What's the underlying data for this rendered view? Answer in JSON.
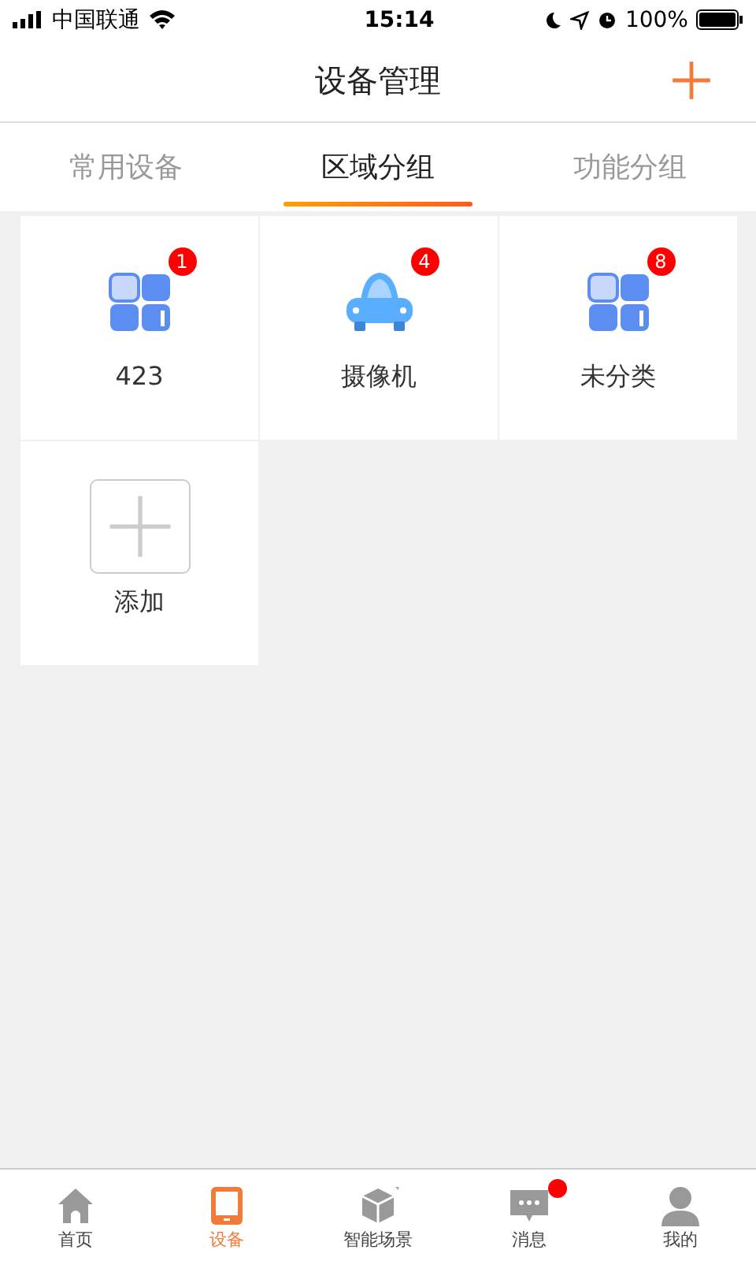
{
  "status_bar": {
    "carrier": "中国联通",
    "time": "15:14",
    "battery": "100%"
  },
  "header": {
    "title": "设备管理"
  },
  "tabs": [
    {
      "label": "常用设备",
      "selected": false
    },
    {
      "label": "区域分组",
      "selected": true
    },
    {
      "label": "功能分组",
      "selected": false
    }
  ],
  "groups": [
    {
      "kind": "grid",
      "label": "423",
      "badge": "1"
    },
    {
      "kind": "car",
      "label": "摄像机",
      "badge": "4"
    },
    {
      "kind": "grid",
      "label": "未分类",
      "badge": "8"
    },
    {
      "kind": "add",
      "label": "添加"
    }
  ],
  "bottom_nav": [
    {
      "kind": "home",
      "label": "首页",
      "selected": false,
      "dot": false
    },
    {
      "kind": "device",
      "label": "设备",
      "selected": true,
      "dot": false
    },
    {
      "kind": "cube",
      "label": "智能场景",
      "selected": false,
      "dot": false
    },
    {
      "kind": "message",
      "label": "消息",
      "selected": false,
      "dot": true
    },
    {
      "kind": "user",
      "label": "我的",
      "selected": false,
      "dot": false
    }
  ]
}
